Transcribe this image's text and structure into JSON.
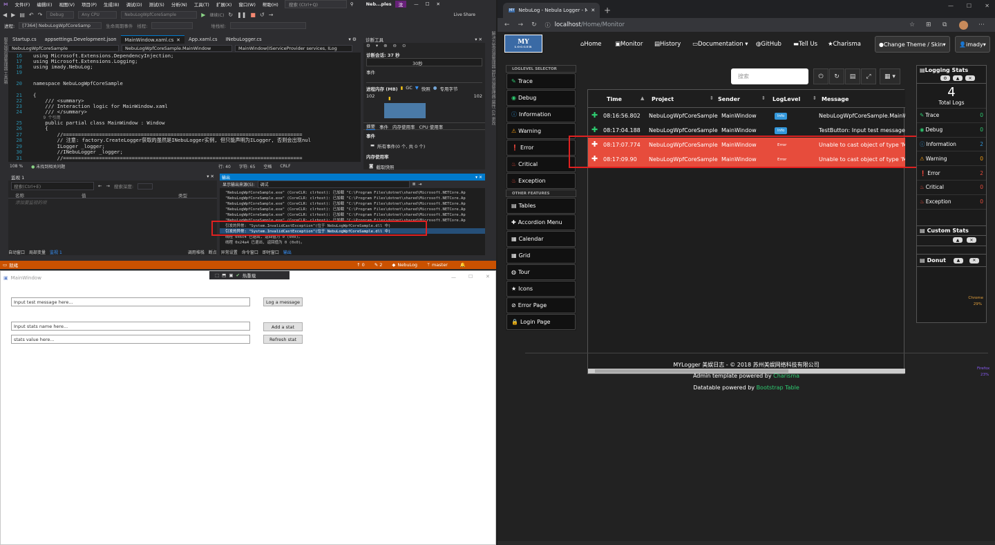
{
  "vs": {
    "menu": [
      "文件(F)",
      "编辑(E)",
      "视图(V)",
      "项目(P)",
      "生成(B)",
      "调试(D)",
      "测试(S)",
      "分析(N)",
      "工具(T)",
      "扩展(X)",
      "窗口(W)",
      "帮助(H)"
    ],
    "search_placeholder": "搜索 (Ctrl+Q)",
    "window_title": "Neb...ples",
    "toolbar": {
      "config": "Debug",
      "platform": "Any CPU",
      "startup": "NebuLogWpfCoreSample",
      "continue": "继续(C)",
      "live_share": "Live Share"
    },
    "progress": {
      "label": "进程:",
      "process": "[7364] NebuLogWpfCoreSamp",
      "lifecycle": "生命周期事件",
      "thread": "线程:",
      "stackframe": "堆栈帧:"
    },
    "tabs": [
      "Startup.cs",
      "appsettings.Development.json",
      "MainWindow.xaml.cs",
      "App.xaml.cs",
      "INebuLogger.cs"
    ],
    "nav": {
      "project": "NebuLogWpfCoreSample",
      "class": "NebuLogWpfCoreSample.MainWindow",
      "member": "MainWindow(IServiceProvider services, ILog"
    },
    "code": [
      {
        "ln": "16",
        "text": "using Microsoft.Extensions.DependencyInjection;"
      },
      {
        "ln": "17",
        "text": "using Microsoft.Extensions.Logging;"
      },
      {
        "ln": "18",
        "text": "using imady.NebuLog;"
      },
      {
        "ln": "19",
        "text": ""
      },
      {
        "ln": "20",
        "text": "namespace NebuLogWpfCoreSample"
      },
      {
        "ln": "21",
        "text": "{"
      },
      {
        "ln": "22",
        "text": "    /// <summary>"
      },
      {
        "ln": "23",
        "text": "    /// Interaction logic for MainWindow.xaml"
      },
      {
        "ln": "24",
        "text": "    /// </summary>"
      },
      {
        "ln": "",
        "text": "    9 个引用"
      },
      {
        "ln": "25",
        "text": "    public partial class MainWindow : Window"
      },
      {
        "ln": "26",
        "text": "    {"
      },
      {
        "ln": "27",
        "text": "        //================================================================================"
      },
      {
        "ln": "28",
        "text": "        // 注意: factory.CreateLogger获取的虽然是INebuLogger实例, 但只能声明为ILogger, 否则会出现nul"
      },
      {
        "ln": "29",
        "text": "        ILogger _logger;"
      },
      {
        "ln": "30",
        "text": "        //INebuLogger _logger;"
      },
      {
        "ln": "31",
        "text": "        //================================================================================"
      },
      {
        "ln": "32",
        "text": ""
      }
    ],
    "editor_status": {
      "zoom": "108 %",
      "issues": "未找到相关问题",
      "row": "行: 40",
      "col": "字符: 65",
      "space": "空格",
      "eol": "CRLF"
    },
    "diag": {
      "title": "诊断工具",
      "session": "诊断会话: 37 秒",
      "timer": "30秒",
      "events": "事件",
      "memory": "进程内存 (MB)",
      "gc": "GC",
      "snapshot": "快照",
      "private": "专用字节",
      "mem_val": "102",
      "tabs": [
        "摘要",
        "事件",
        "内存使用率",
        "CPU 使用率"
      ],
      "events_head": "事件",
      "all_events": "所有事件(0 个, 共 0 个)",
      "mem_usage": "内存使用率",
      "take_snapshot": "截取快照"
    },
    "watch": {
      "title": "监视 1",
      "search": "搜索(Ctrl+E)",
      "depth": "搜索深度:",
      "col_name": "名称",
      "col_value": "值",
      "col_type": "类型",
      "add_item": "添加要监视的项"
    },
    "output": {
      "title": "输出",
      "source_label": "显示输出来源(S):",
      "source": "调试",
      "lines": [
        "\"NebuLogWpfCoreSample.exe\" (CoreCLR: clrhost): 已加载 \"C:\\Program Files\\dotnet\\shared\\Microsoft.NETCore.Ap",
        "\"NebuLogWpfCoreSample.exe\" (CoreCLR: clrhost): 已加载 \"C:\\Program Files\\dotnet\\shared\\Microsoft.NETCore.Ap",
        "\"NebuLogWpfCoreSample.exe\" (CoreCLR: clrhost): 已加载 \"C:\\Program Files\\dotnet\\shared\\Microsoft.NETCore.Ap",
        "\"NebuLogWpfCoreSample.exe\" (CoreCLR: clrhost): 已加载 \"C:\\Program Files\\dotnet\\shared\\Microsoft.NETCore.Ap",
        "\"NebuLogWpfCoreSample.exe\" (CoreCLR: clrhost): 已加载 \"C:\\Program Files\\dotnet\\shared\\Microsoft.NETCore.Ap",
        "\"NebuLogWpfCoreSample.exe\" (CoreCLR: clrhost): 已加载 \"C:\\Program Files\\dotnet\\shared\\Microsoft.NETCore.Ap",
        "引发的异常: \"System.InvalidCastException\"(位于 NebuLogWpfCoreSample.dll 中)",
        "引发的异常: \"System.InvalidCastException\"(位于 NebuLogWpfCoreSample.dll 中)",
        "线程 0x6c4 已退出, 返回值为 0 (0x0)。",
        "线程 0x24a4 已退出, 返回值为 0 (0x0)。"
      ]
    },
    "bottom_tabs_left": [
      "自动窗口",
      "局部变量",
      "监视 1"
    ],
    "bottom_tabs_right": [
      "调用堆栈",
      "断点",
      "异常设置",
      "命令窗口",
      "即时窗口",
      "输出"
    ],
    "statusbar": {
      "state": "就绪",
      "up": "0",
      "pencil": "2",
      "repo": "NebuLog",
      "branch": "master"
    }
  },
  "wpf": {
    "title": "MainWindow",
    "hot_reload": "热重载",
    "test_message": "Input test message here...",
    "log_button": "Log a message",
    "stat_name": "Input stats name here...",
    "add_stat_button": "Add a stat",
    "stat_value": "stats value here...",
    "refresh_button": "Refresh stat"
  },
  "browser": {
    "tab_title": "NebuLog - Nebula Logger - MYL",
    "url_host": "localhost",
    "url_path": "/Home/Monitor",
    "logo": "MY",
    "logo_sub": "LOGGER",
    "nav": [
      "Home",
      "Monitor",
      "History",
      "Documentation",
      "GitHub",
      "Tell Us",
      "Charisma"
    ],
    "theme_btn": "Change Theme / Skin",
    "user_btn": "imady",
    "left_head1": "LOGLEVEL SELECTOR",
    "levels": [
      "Trace",
      "Debug",
      "Information",
      "Warning",
      "Error",
      "Critical",
      "Exception"
    ],
    "left_head2": "OTHER FEATURES",
    "features": [
      "Tables",
      "Accordion Menu",
      "Calendar",
      "Grid",
      "Tour",
      "Icons",
      "Error Page",
      "Login Page"
    ],
    "search_placeholder": "搜索",
    "columns": [
      "Time",
      "Project",
      "Sender",
      "LogLevel",
      "Message"
    ],
    "rows": [
      {
        "time": "08:16:56.802",
        "project": "NebuLogWpfCoreSample",
        "sender": "MainWindow",
        "level": "Info",
        "message": "NebuLogWpfCoreSample.MainW"
      },
      {
        "time": "08:17:04.188",
        "project": "NebuLogWpfCoreSample",
        "sender": "MainWindow",
        "level": "Info",
        "message": "TestButton: Input test message he"
      },
      {
        "time": "08:17:07.774",
        "project": "NebuLogWpfCoreSample",
        "sender": "MainWindow",
        "level": "Error",
        "message": "Unable to cast object of type 'Micr"
      },
      {
        "time": "08:17:09.90",
        "project": "NebuLogWpfCoreSample",
        "sender": "MainWindow",
        "level": "Error",
        "message": "Unable to cast object of type 'Micr"
      }
    ],
    "logging_stats": {
      "title": "Logging Stats",
      "total": "4",
      "total_label": "Total Logs",
      "items": [
        {
          "name": "Trace",
          "count": "0",
          "color": "#2ecc71"
        },
        {
          "name": "Debug",
          "count": "0",
          "color": "#2ecc71"
        },
        {
          "name": "Information",
          "count": "2",
          "color": "#3498db"
        },
        {
          "name": "Warning",
          "count": "0",
          "color": "#f39c12"
        },
        {
          "name": "Error",
          "count": "2",
          "color": "#e74c3c"
        },
        {
          "name": "Critical",
          "count": "0",
          "color": "#e74c3c"
        },
        {
          "name": "Exception",
          "count": "0",
          "color": "#e74c3c"
        }
      ]
    },
    "custom_stats": {
      "title": "Custom Stats"
    },
    "donut": {
      "title": "Donut",
      "chrome_label": "Chrome",
      "chrome_pct": "29%",
      "firefox_label": "Firefox",
      "firefox_pct": "23%"
    },
    "footer": {
      "line1": "MYLogger 美娱日志 - © 2018 苏州美娱网络科技有限公司",
      "line2_prefix": "Admin template powered by ",
      "line2_link": "Charisma",
      "line3_prefix": "Datatable powered by ",
      "line3_link": "Bootstrap Table"
    }
  }
}
